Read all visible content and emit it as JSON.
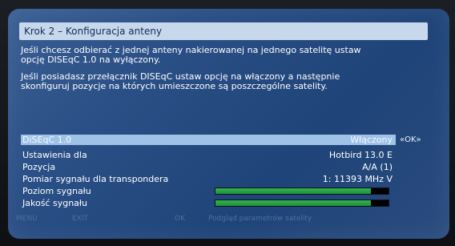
{
  "screen": {
    "title": "Krok 2 – Konfiguracja anteny",
    "info": [
      "Jeśli chcesz odbierać z jednej anteny nakierowanej na jednego satelitę ustaw opcję DISEqC 1.0 na wyłączony.",
      "Jeśli posiadasz przełącznik DISEqC ustaw opcję na włączony a następnie skonfiguruj pozycje na których umieszczone są poszczególne satelity."
    ],
    "diseqc": {
      "label": "DiSEqC 1.0",
      "value": "Włączony",
      "hint": "«OK»"
    },
    "rows": [
      {
        "label": "Ustawienia dla",
        "value": "Hotbird 13.0 E"
      },
      {
        "label": "Pozycja",
        "value": "A/A (1)"
      },
      {
        "label": "Pomiar sygnału dla transpondera",
        "value": "1: 11393 MHz V"
      }
    ],
    "signal_level": {
      "label": "Poziom sygnału",
      "fraction": 0.9
    },
    "signal_quality": {
      "label": "Jakość sygnału",
      "fraction": 0.9
    },
    "footer": {
      "item1": "MENU",
      "item2": "EXIT",
      "item3": "OK",
      "item4": "Podgląd parametrów satelity"
    }
  }
}
